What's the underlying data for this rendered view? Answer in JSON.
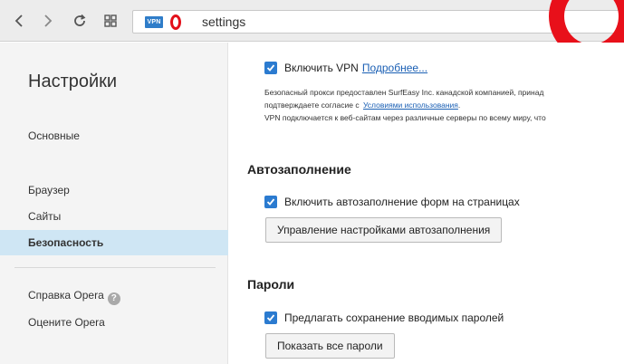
{
  "toolbar": {
    "url_text": "settings",
    "vpn_badge": "VPN"
  },
  "sidebar": {
    "title": "Настройки",
    "items": [
      {
        "label": "Основные"
      },
      {
        "label": "Браузер"
      },
      {
        "label": "Сайты"
      },
      {
        "label": "Безопасность",
        "active": true
      }
    ],
    "footer": [
      {
        "label": "Справка Opera"
      },
      {
        "label": "Оцените Opera"
      }
    ],
    "help_icon": "?"
  },
  "main": {
    "vpn": {
      "checkbox_label": "Включить VPN",
      "checked": true,
      "more_link": "Подробнее...",
      "desc_line1": "Безопасный прокси предоставлен SurfEasy Inc. канадской компанией, принад",
      "desc_line2_prefix": "подтверждаете согласие с",
      "desc_line2_link": "Условиями использования",
      "desc_line3": "VPN подключается к веб-сайтам через различные серверы по всему миру, что"
    },
    "autofill": {
      "title": "Автозаполнение",
      "checkbox_label": "Включить автозаполнение форм на страницах",
      "checked": true,
      "button_label": "Управление настройками автозаполнения"
    },
    "passwords": {
      "title": "Пароли",
      "checkbox_label": "Предлагать сохранение вводимых паролей",
      "checked": true,
      "button_label": "Показать все пароли"
    }
  },
  "colors": {
    "accent": "#2b7bd0",
    "opera_red": "#e8101a",
    "sidebar_active": "#cfe6f4"
  }
}
